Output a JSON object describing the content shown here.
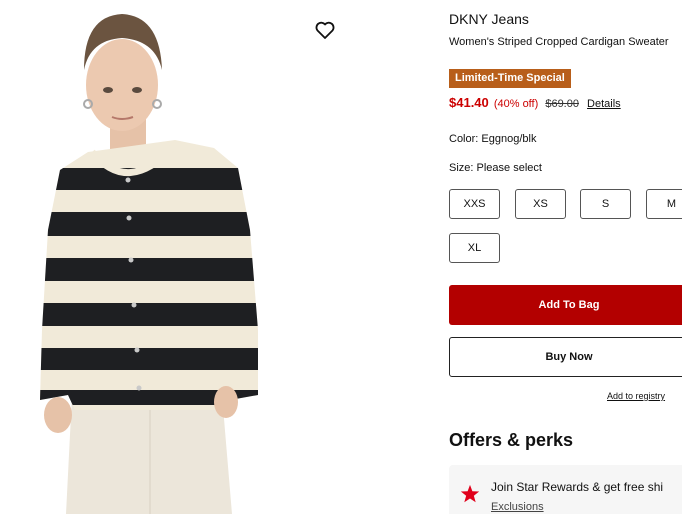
{
  "product": {
    "brand": "DKNY Jeans",
    "name": "Women's Striped Cropped Cardigan Sweater",
    "badge": "Limited-Time Special",
    "sale_price": "$41.40",
    "discount": "(40% off)",
    "original_price": "$69.00",
    "details_link": "Details",
    "color_label": "Color: Eggnog/blk",
    "size_label": "Size: Please select",
    "sizes": [
      "XXS",
      "XS",
      "S",
      "M",
      "XL"
    ]
  },
  "actions": {
    "add_to_bag": "Add To Bag",
    "buy_now": "Buy Now",
    "add_to_registry": "Add to registry"
  },
  "offers": {
    "title": "Offers & perks",
    "card_text": "Join Star Rewards & get free shi",
    "card_link": "Exclusions"
  },
  "icons": {
    "wishlist": "heart-outline-icon",
    "rewards": "star-icon"
  },
  "colors": {
    "badge": "#b85e1a",
    "sale": "#cc0000",
    "primary_button": "#b30000"
  }
}
